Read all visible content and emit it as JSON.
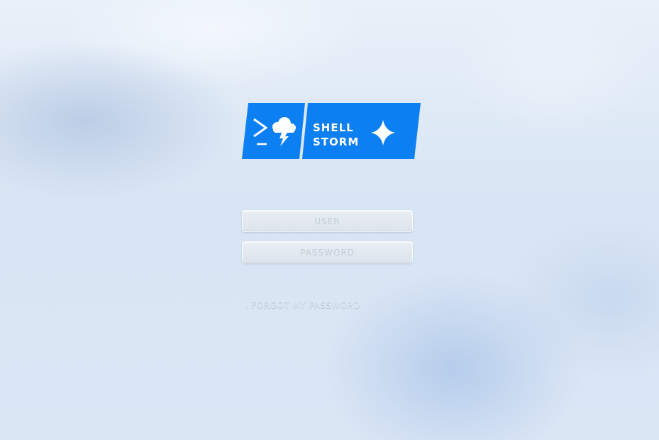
{
  "logo": {
    "line1": "SHELL",
    "line2": "STORM",
    "brand_color": "#0c7ff2",
    "icons": [
      "terminal-prompt-icon",
      "cloud-lightning-icon",
      "sparkle-icon"
    ]
  },
  "login": {
    "user_placeholder": "USER",
    "password_placeholder": "PASSWORD",
    "forgot_password_label": "I FORGOT MY PASSWORD"
  }
}
